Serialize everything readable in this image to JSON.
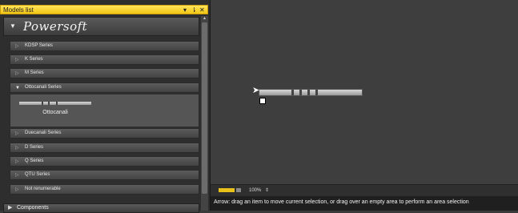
{
  "window": {
    "panel_title": "Models list",
    "pin_icon": "pin-icon",
    "close_icon": "close-icon"
  },
  "brand": {
    "logo_text": "Powersoft"
  },
  "series": [
    {
      "label": "KDSP Series"
    },
    {
      "label": "K Series"
    },
    {
      "label": "M Series"
    },
    {
      "label": "Ottocanali Series"
    },
    {
      "label": "Duecanali Series"
    },
    {
      "label": "D Series"
    },
    {
      "label": "Q Series"
    },
    {
      "label": "QTU Series"
    },
    {
      "label": "Not renumerable"
    }
  ],
  "expanded": {
    "device_label": "Ottocanali"
  },
  "bottom_group": {
    "label": "Components"
  },
  "toolbar": {
    "zoom": "100%"
  },
  "status": {
    "message": "Arrow: drag an item to move current selection, or drag over an empty area to perform an area selection"
  },
  "colors": {
    "title_bar": "#f1c515",
    "background": "#3a3a3a",
    "toolbar_accent": "#e8c21a"
  }
}
